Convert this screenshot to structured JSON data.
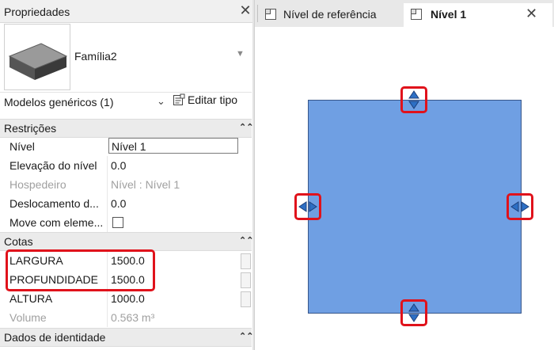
{
  "properties_panel": {
    "title": "Propriedades",
    "type_name": "Família2",
    "category": "Modelos genéricos (1)",
    "edit_type_label": "Editar tipo",
    "sections": {
      "constraints": "Restrições",
      "dimensions": "Cotas",
      "identity": "Dados de identidade"
    },
    "constraints_rows": [
      {
        "label": "Nível",
        "value": "Nível 1"
      },
      {
        "label": "Elevação do nível",
        "value": "0.0"
      },
      {
        "label": "Hospedeiro",
        "value": "Nível : Nível 1"
      },
      {
        "label": "Deslocamento d...",
        "value": "0.0"
      },
      {
        "label": "Move com eleme...",
        "value": ""
      }
    ],
    "dimension_rows": [
      {
        "label": "LARGURA",
        "value": "1500.0"
      },
      {
        "label": "PROFUNDIDADE",
        "value": "1500.0"
      },
      {
        "label": "ALTURA",
        "value": "1000.0"
      },
      {
        "label": "Volume",
        "value": "0.563 m³"
      }
    ],
    "move_with_elements_checked": false
  },
  "tabs": [
    {
      "label": "Nível de referência",
      "active": false
    },
    {
      "label": "Nível 1",
      "active": true
    }
  ],
  "colors": {
    "element_fill": "#6f9fe3",
    "element_border": "#37568a",
    "highlight": "#e0121b",
    "handle_arrow": "#2d6fc4"
  },
  "icons": {
    "panel_close": "close-icon",
    "tab_close": "close-icon",
    "collapse": "chevron-up-double-icon",
    "category_dropdown": "chevron-down-icon",
    "edit_type": "edit-type-icon",
    "view_tab": "view-icon",
    "handle_vertical": "vertical-drag-handle-icon",
    "handle_horizontal": "horizontal-drag-handle-icon"
  }
}
